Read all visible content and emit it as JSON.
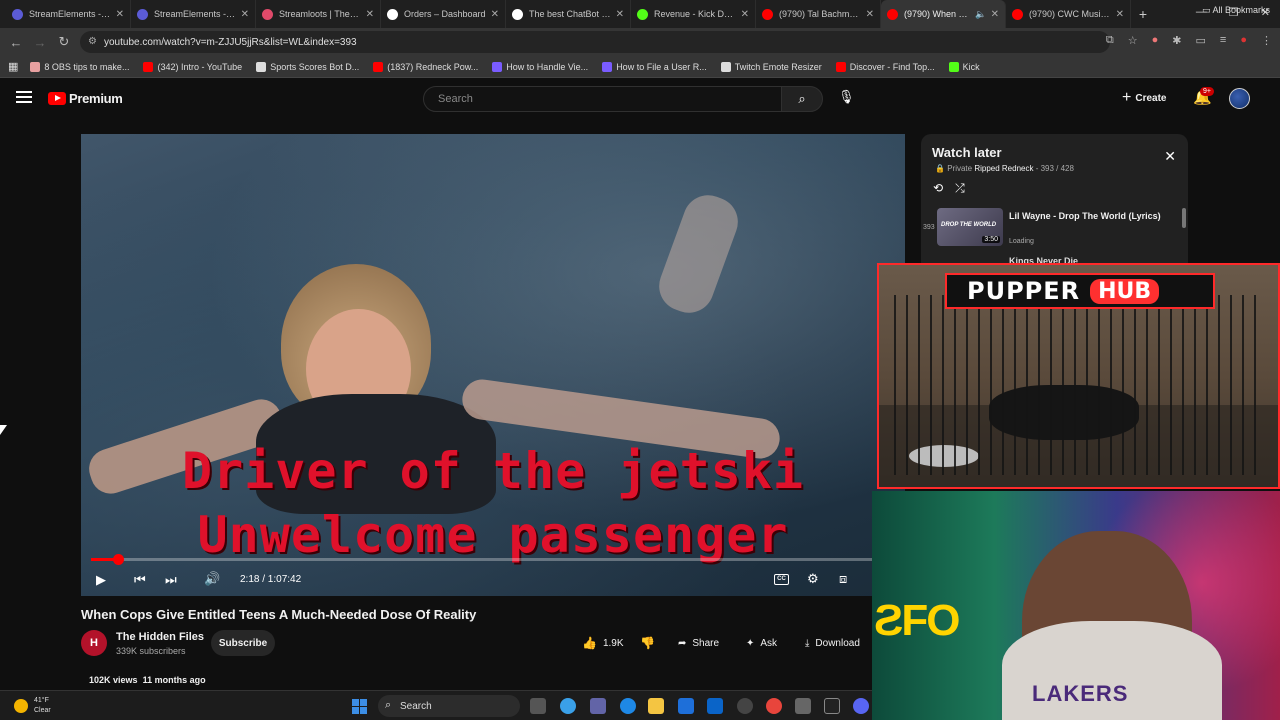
{
  "browser": {
    "tabs": [
      {
        "label": "StreamElements - Ove",
        "color": "#5b5bd6"
      },
      {
        "label": "StreamElements - ripp",
        "color": "#5b5bd6"
      },
      {
        "label": "Streamloots | Therippe",
        "color": "#e04a6a"
      },
      {
        "label": "Orders – Dashboard",
        "color": "#ffffff"
      },
      {
        "label": "The best ChatBot and",
        "color": "#ffffff"
      },
      {
        "label": "Revenue - Kick Dashb",
        "color": "#53fc18"
      },
      {
        "label": "(9790) Tal Bachman -",
        "color": "#ff0000"
      },
      {
        "label": "(9790) When Cops",
        "color": "#ff0000",
        "active": true
      },
      {
        "label": "(9790) CWC Music Vi",
        "color": "#ff0000"
      }
    ],
    "url": "youtube.com/watch?v=m-ZJJU5jjRs&list=WL&index=393",
    "bookmarks": [
      {
        "label": "8 OBS tips to make...",
        "color": "#e8a0a0"
      },
      {
        "label": "(342) Intro - YouTube",
        "color": "#ff0000"
      },
      {
        "label": "Sports Scores Bot D...",
        "color": "#dddddd"
      },
      {
        "label": "(1837) Redneck Pow...",
        "color": "#ff0000"
      },
      {
        "label": "How to Handle Vie...",
        "color": "#7a5cff"
      },
      {
        "label": "How to File a User R...",
        "color": "#7a5cff"
      },
      {
        "label": "Twitch Emote Resizer",
        "color": "#dddddd"
      },
      {
        "label": "Discover - Find Top...",
        "color": "#ff0000"
      },
      {
        "label": "Kick",
        "color": "#53fc18"
      }
    ],
    "all_bookmarks": "All Bookmarks"
  },
  "youtube": {
    "brand": "Premium",
    "search_placeholder": "Search",
    "create_label": "Create",
    "notif_badge": "9+"
  },
  "video": {
    "caption_line1": "Driver of the jetski",
    "caption_line2": "Unwelcome passenger",
    "time": "2:18 / 1:07:42",
    "progress": 0.034,
    "title": "When Cops Give Entitled Teens A Much-Needed Dose Of Reality",
    "channel": "The Hidden Files",
    "subscribers": "339K subscribers",
    "subscribe_label": "Subscribe",
    "likes": "1.9K",
    "share_label": "Share",
    "ask_label": "Ask",
    "download_label": "Download",
    "views": "102K views",
    "age": "11 months ago"
  },
  "watch_later": {
    "title": "Watch later",
    "privacy": "Private",
    "owner": "Ripped Redneck",
    "position": "393 / 428",
    "item_index": "393",
    "item_thumb_text": "DROP THE WORLD",
    "item_title": "Lil Wayne - Drop The World (Lyrics)",
    "item_duration": "3:50",
    "item_status": "Loading",
    "next_title": "Kings Never Die"
  },
  "overlay": {
    "pupper": "PUPPER",
    "hub": "HUB",
    "jersey": "LAKERS"
  },
  "taskbar": {
    "temp": "41°F",
    "condition": "Clear",
    "search": "Search"
  }
}
